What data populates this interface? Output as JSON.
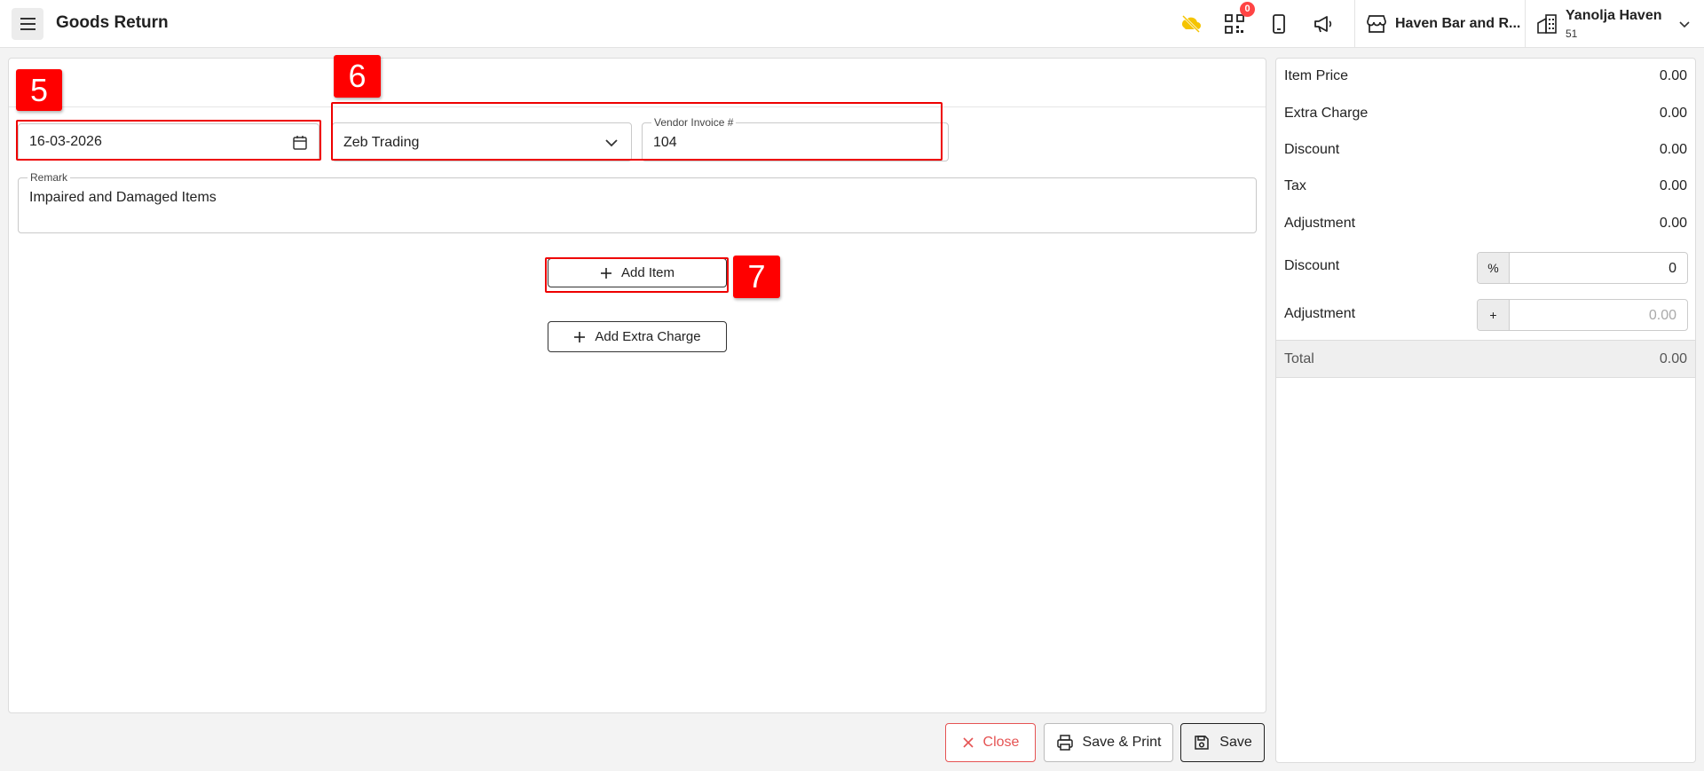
{
  "header": {
    "title": "Goods Return",
    "notification_count": "0",
    "store_name": "Haven Bar and R...",
    "user_name": "Yanolja Haven",
    "user_id": "51"
  },
  "form": {
    "date": "16-03-2026",
    "vendor": "Zeb Trading",
    "vendor_invoice_label": "Vendor Invoice #",
    "vendor_invoice": "104",
    "remark_label": "Remark",
    "remark": "Impaired and Damaged Items",
    "add_item_label": "Add Item",
    "add_extra_charge_label": "Add Extra Charge"
  },
  "markers": {
    "m5": "5",
    "m6": "6",
    "m7": "7"
  },
  "footer": {
    "close_label": "Close",
    "save_print_label": "Save & Print",
    "save_label": "Save"
  },
  "summary": {
    "item_price_label": "Item Price",
    "item_price": "0.00",
    "extra_charge_label": "Extra Charge",
    "extra_charge": "0.00",
    "discount_label": "Discount",
    "discount": "0.00",
    "tax_label": "Tax",
    "tax": "0.00",
    "adjustment_label": "Adjustment",
    "adjustment": "0.00",
    "discount_input_label": "Discount",
    "discount_prefix": "%",
    "discount_input_value": "0",
    "adjustment_input_label": "Adjustment",
    "adjustment_prefix": "+",
    "adjustment_input_placeholder": "0.00",
    "total_label": "Total",
    "total": "0.00"
  },
  "colors": {
    "annotation_red": "#ff0000",
    "close_red": "#e55353",
    "badge_red": "#ff4444",
    "weather_icon_yellow": "#f5c400"
  }
}
